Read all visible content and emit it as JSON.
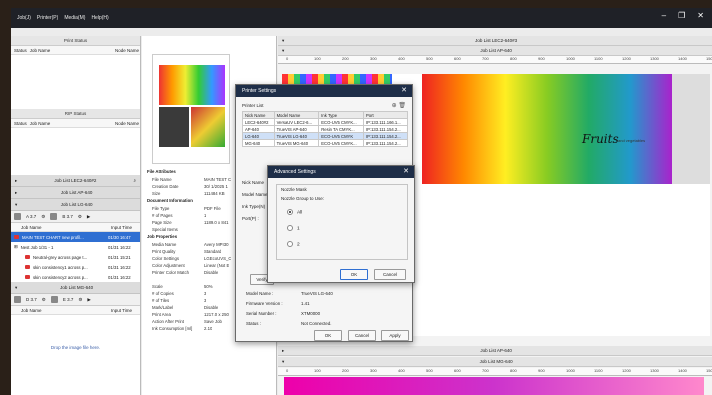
{
  "menu": [
    "Job(J)",
    "Printer(P)",
    "Media(M)",
    "Help(H)"
  ],
  "window_controls": {
    "minimize": "–",
    "restore": "❐",
    "close": "✕"
  },
  "left": {
    "print_status": {
      "title": "Print Status",
      "cols": [
        "Status",
        "Job Name",
        "Node Name"
      ]
    },
    "rip_status": {
      "title": "RIP Status",
      "cols": [
        "Status",
        "Job Name",
        "Node Name"
      ]
    },
    "job_lists": [
      "Job List LEC2-640#2",
      "Job List AP-640",
      "Job List LG-640"
    ],
    "toolbar": {
      "a": "A 3.7",
      "b": "B 3.7"
    },
    "job_cols": [
      "Job Name",
      "Input Time"
    ],
    "jobs": [
      {
        "name": "MAIN TEST CHART new profil...",
        "time": "01/30 16:47",
        "sel": true
      },
      {
        "name": "Nest Job 1/31 - 1",
        "time": "01/31 16:22",
        "sel": false
      },
      {
        "name": "Neutral-grey across page t...",
        "time": "01/31 15:21",
        "sel": false
      },
      {
        "name": "skin consistency1 across p...",
        "time": "01/31 16:22",
        "sel": false
      },
      {
        "name": "skin consistency2 across p...",
        "time": "01/31 16:22",
        "sel": false
      }
    ],
    "mg_list": "Job List MG-640",
    "toolbar2": {
      "a": "D 3.7",
      "b": "E 3.7"
    },
    "drop_hint": "Drop the image file here."
  },
  "mid": {
    "file_attr_title": "File Attributes",
    "file_attrs": [
      {
        "k": "File Name",
        "v": "MAIN TEST C"
      },
      {
        "k": "Creation Date",
        "v": "30/ 1/2025 1"
      },
      {
        "k": "Size",
        "v": "111484 KB"
      }
    ],
    "doc_info_title": "Document Information",
    "doc_info": [
      {
        "k": "File Type",
        "v": "PDF File"
      },
      {
        "k": "# of Pages",
        "v": "1"
      },
      {
        "k": "Page Size",
        "v": "1189.0 x 841"
      },
      {
        "k": "Special Items",
        "v": ""
      }
    ],
    "job_props_title": "Job Properties",
    "job_props": [
      {
        "k": "Media Name",
        "v": "Avery MPI30"
      },
      {
        "k": "Print Quality",
        "v": "Standard"
      },
      {
        "k": "Color Settings",
        "v": "LGEcoUVS_C"
      },
      {
        "k": "Color Adjustment",
        "v": "Linear (Not E"
      },
      {
        "k": "Printer Color Match",
        "v": "Disable"
      },
      {
        "k": "",
        "v": ""
      },
      {
        "k": "Scale",
        "v": "50%"
      },
      {
        "k": "# of Copies",
        "v": "3"
      },
      {
        "k": "# of Tiles",
        "v": "3"
      },
      {
        "k": "Mark/Label",
        "v": "Disable"
      },
      {
        "k": "Print Area",
        "v": "1217.0 x 250"
      },
      {
        "k": "Action After Print",
        "v": "Save Job"
      },
      {
        "k": "Ink Consumption [ml]",
        "v": "2.10"
      }
    ]
  },
  "right": {
    "collapsed_list": "Job List LEC2-640#3",
    "active_list": "Job List AP-640",
    "ruler_ticks": [
      "0",
      "100",
      "200",
      "300",
      "400",
      "500",
      "600",
      "700",
      "800",
      "900",
      "1000",
      "1100",
      "1200",
      "1300",
      "1400",
      "1500"
    ],
    "lower_list_1": "Job List AP-640",
    "lower_list_2": "Job List MG-640",
    "preview_text": "Fruits",
    "preview_sub": "and vegetables"
  },
  "printer_settings": {
    "title": "Printer Settings",
    "list_label": "Printer List",
    "cols": [
      "Nick Name",
      "Model Name",
      "Ink Type",
      "Port"
    ],
    "rows": [
      [
        "LEC2-640#2",
        "VersaUV LEC2-6...",
        "ECO-UV5 CMYK...",
        "IP:133.111.166.1..."
      ],
      [
        "AP-640",
        "TrueVIS AP-640",
        "Resin TA CMYK...",
        "IP:133.111.154.2..."
      ],
      [
        "LG-640",
        "TrueVIS LG-640",
        "ECO-UV5 CMYK",
        "IP:133.111.154.2..."
      ],
      [
        "MG-640",
        "TrueVIS MG-640",
        "ECO-UV5 CMYK...",
        "IP:133.111.154.2..."
      ]
    ],
    "side_labels": [
      "Nick Name",
      "Model Name",
      "Ink Type(N)",
      "Port(P) :"
    ],
    "verify_btn": "Verify",
    "details": [
      {
        "k": "Model Name :",
        "v": "TrueVIS LG-640"
      },
      {
        "k": "Firmware Version :",
        "v": "1.41"
      },
      {
        "k": "Serial Number :",
        "v": "XTM0000"
      },
      {
        "k": "Status :",
        "v": "Not Connected."
      }
    ],
    "ok": "OK",
    "cancel": "Cancel",
    "apply": "Apply"
  },
  "advanced": {
    "title": "Advanced Settings",
    "nozzle_mask": "Nozzle Mask",
    "group_label": "Nozzle Group to Use:",
    "options": [
      "All",
      "1",
      "2"
    ],
    "selected": "All",
    "ok": "OK",
    "cancel": "Cancel"
  }
}
